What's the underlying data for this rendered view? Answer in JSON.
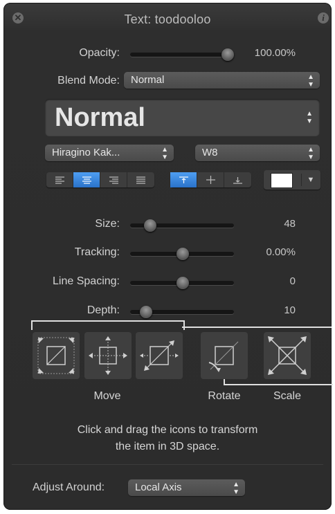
{
  "title": "Text: toodooloo",
  "header": {
    "close_icon": "close-icon",
    "info_glyph": "i"
  },
  "opacity": {
    "label": "Opacity:",
    "value": "100.00%",
    "fraction": 1.0
  },
  "blend_mode": {
    "label": "Blend Mode:",
    "value": "Normal"
  },
  "style_preset": {
    "value": "Normal"
  },
  "font": {
    "family": "Hiragino Kak...",
    "weight": "W8"
  },
  "alignment": {
    "horizontal_selected": "center",
    "vertical_selected": "top"
  },
  "face_color": "#ffffff",
  "size": {
    "label": "Size:",
    "value": "48",
    "fraction": 0.18
  },
  "tracking": {
    "label": "Tracking:",
    "value": "0.00%",
    "fraction": 0.5
  },
  "line_spacing": {
    "label": "Line Spacing:",
    "value": "0",
    "fraction": 0.5
  },
  "depth": {
    "label": "Depth:",
    "value": "10",
    "fraction": 0.12
  },
  "transform": {
    "move_label": "Move",
    "rotate_label": "Rotate",
    "scale_label": "Scale"
  },
  "help": {
    "line1": "Click and drag the icons to transform",
    "line2": "the item in 3D space."
  },
  "adjust_around": {
    "label": "Adjust Around:",
    "value": "Local Axis"
  },
  "colors": {
    "panel": "#2e2e2e",
    "accent": "#2f7fdc",
    "text": "#d6d6d6"
  }
}
